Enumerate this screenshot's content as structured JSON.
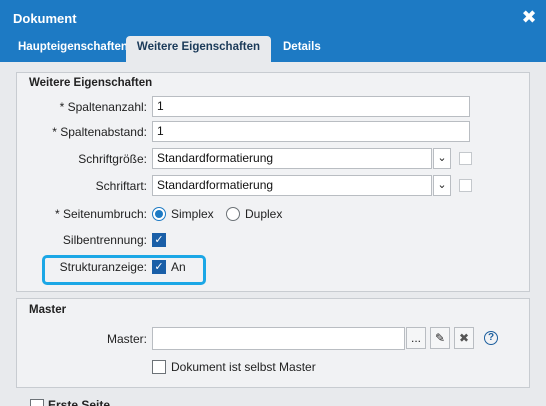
{
  "dialog": {
    "title": "Dokument"
  },
  "tabs": [
    "Haupteigenschaften",
    "Weitere Eigenschaften",
    "Details"
  ],
  "weitere": {
    "legend": "Weitere Eigenschaften",
    "spaltenanzahl_label": "* Spaltenanzahl:",
    "spaltenanzahl_value": "1",
    "spaltenabstand_label": "* Spaltenabstand:",
    "spaltenabstand_value": "1",
    "schriftgroesse_label": "Schriftgröße:",
    "schriftgroesse_value": "Standardformatierung",
    "schriftart_label": "Schriftart:",
    "schriftart_value": "Standardformatierung",
    "seitenumbruch_label": "* Seitenumbruch:",
    "simplex_label": "Simplex",
    "duplex_label": "Duplex",
    "silbentrennung_label": "Silbentrennung:",
    "strukturanzeige_label": "Strukturanzeige:",
    "strukturanzeige_value": "An"
  },
  "master": {
    "legend": "Master",
    "master_label": "Master:",
    "master_value": "",
    "browse_label": "...",
    "selbst_master_label": "Dokument ist selbst Master"
  },
  "erste_seite_label": "Erste Seite",
  "highlight_color": "#1ba7e6",
  "accent_color": "#1d7ac4"
}
